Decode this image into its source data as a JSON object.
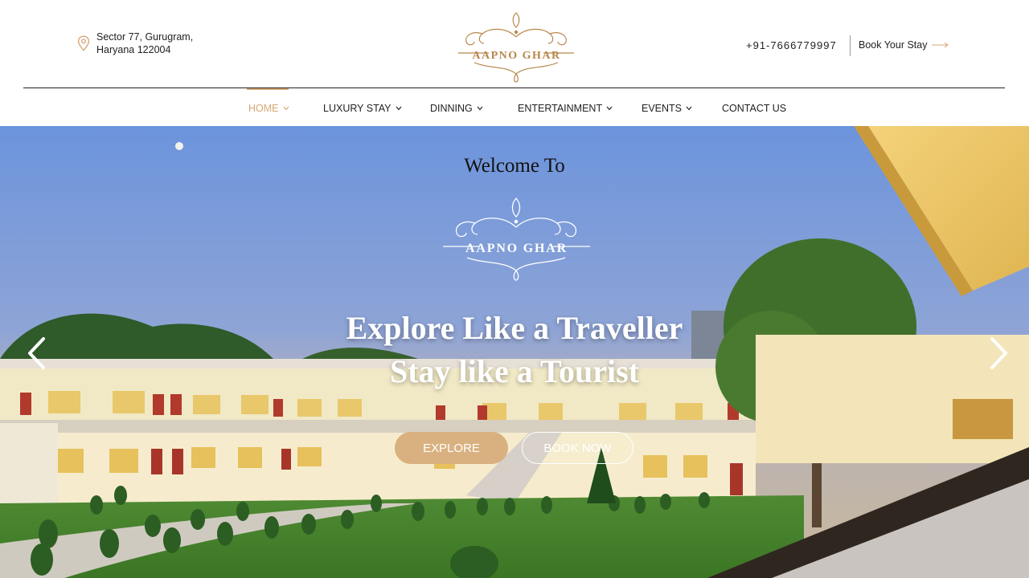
{
  "header": {
    "address_line1": "Sector 77, Gurugram,",
    "address_line2": "Haryana 122004",
    "logo_text": "AAPNO GHAR",
    "phone": "+91-7666779997",
    "book_stay_label": "Book Your Stay"
  },
  "nav": {
    "items": [
      {
        "label": "HOME",
        "active": true
      },
      {
        "label": "LUXURY STAY"
      },
      {
        "label": "DINNING"
      },
      {
        "label": "ENTERTAINMENT"
      },
      {
        "label": "EVENTS"
      },
      {
        "label": "CONTACT US"
      }
    ]
  },
  "hero": {
    "welcome": "Welcome To",
    "logo_text": "AAPNO GHAR",
    "headline_line1": "Explore Like a Traveller",
    "headline_line2": "Stay like a Tourist",
    "explore_label": "EXPLORE",
    "book_now_label": "BOOK NOW"
  },
  "colors": {
    "accent": "#d7a877",
    "gold": "#b8864b",
    "button_fill": "#d9b180"
  },
  "icons": {
    "location": "map-pin-icon",
    "arrow": "arrow-right-icon",
    "dropdown": "chevron-down-icon",
    "prev": "chevron-left-icon",
    "next": "chevron-right-icon"
  }
}
